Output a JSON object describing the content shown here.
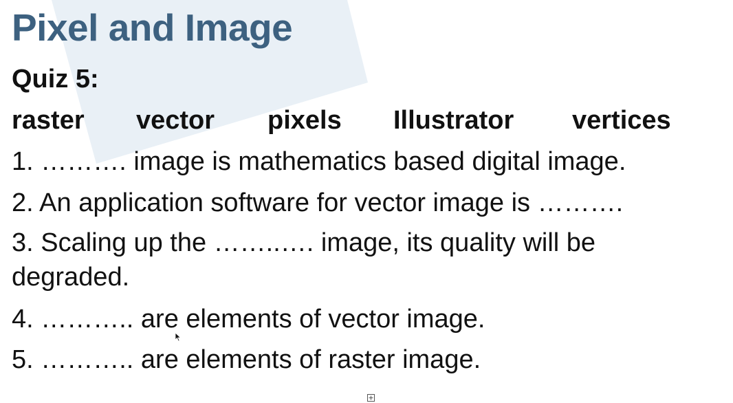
{
  "slide": {
    "title": "Pixel and Image",
    "quiz_label": "Quiz 5:",
    "word_bank": [
      "raster",
      "vector",
      "pixels",
      "Illustrator",
      "vertices"
    ],
    "questions": [
      "1. ………. image is mathematics based digital image.",
      "2. An application software for vector image is ……….",
      "3. Scaling up the ……..…. image, its quality will be degraded.",
      "4. ……….. are elements of vector image.",
      "5. ……….. are elements of raster image."
    ]
  },
  "colors": {
    "title": "#3d6180",
    "text": "#111111",
    "background_shape": "#e9f0f6"
  },
  "icons": {
    "cursor": "mouse-pointer-icon",
    "toggle": "expand-box-icon"
  }
}
